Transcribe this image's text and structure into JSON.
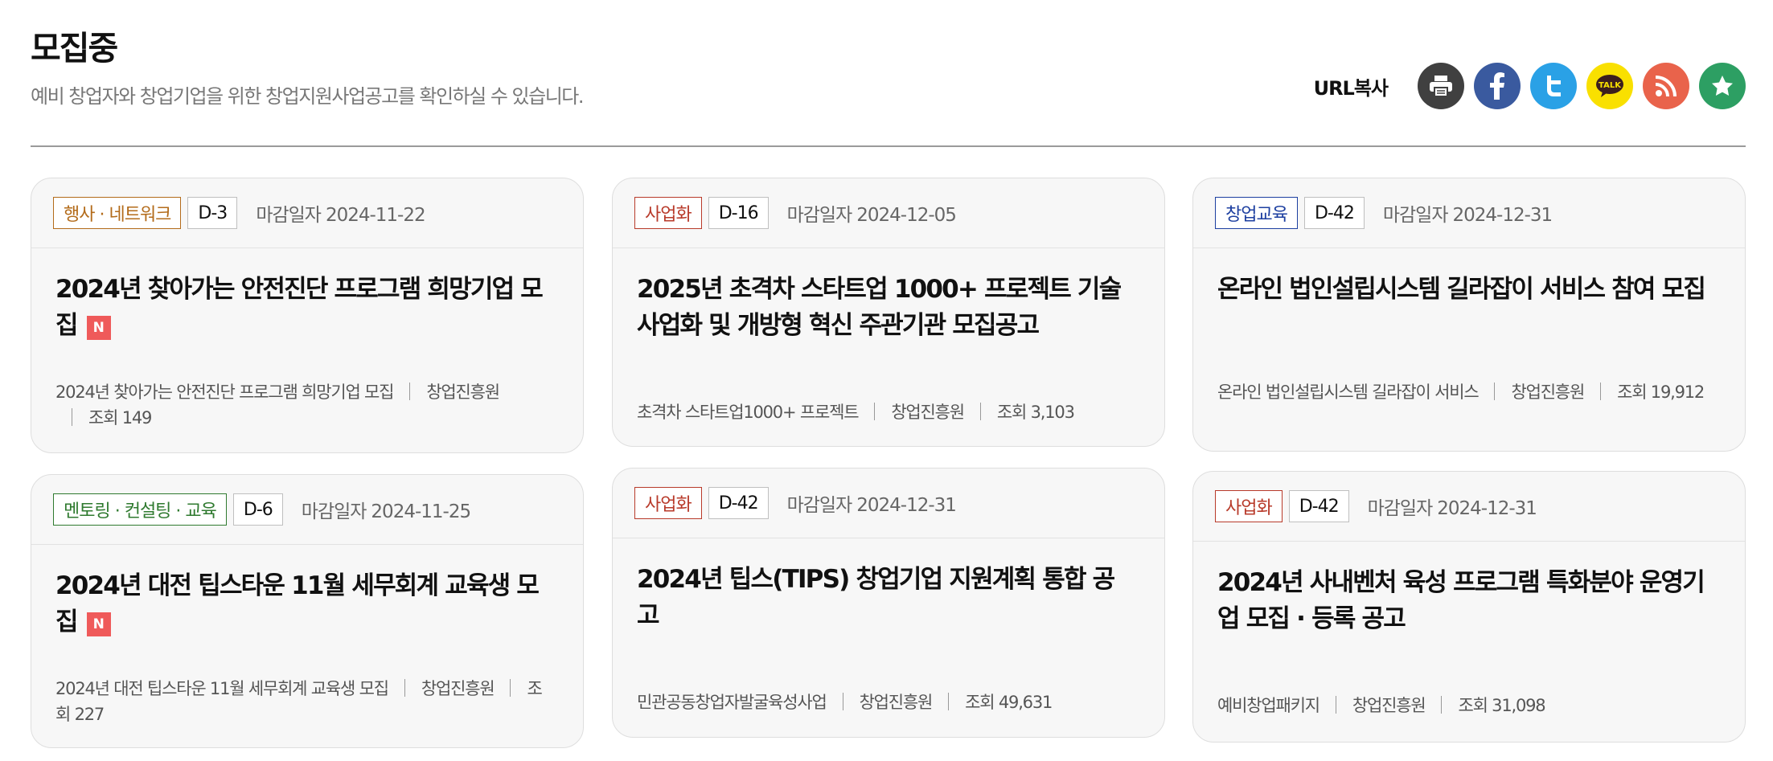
{
  "page": {
    "title": "모집중",
    "subtitle": "예비 창업자와 창업기업을 위한 창업지원사업공고를 확인하실 수 있습니다."
  },
  "share": {
    "url_copy_label": "URL복사",
    "kakao_label": "TALK",
    "colors": {
      "print": "#404040",
      "facebook": "#3a5a9f",
      "twitter": "#2aa1e6",
      "kakao": "#f9e000",
      "rss": "#e9634b",
      "favorite": "#2d9f63"
    }
  },
  "deadline_label": "마감일자",
  "new_label": "N",
  "cards": [
    {
      "category": "행사 · 네트워크",
      "category_color": "#b36b1a",
      "dday": "D-3",
      "deadline": "2024-11-22",
      "title": "2024년 찾아가는 안전진단 프로그램 희망기업 모집",
      "is_new": true,
      "business": "2024년 찾아가는 안전진단 프로그램 희망기업 모집",
      "org": "창업진흥원",
      "views": "조회 149"
    },
    {
      "category": "사업화",
      "category_color": "#b83a2a",
      "dday": "D-16",
      "deadline": "2024-12-05",
      "title": "2025년 초격차 스타트업 1000+ 프로젝트 기술사업화 및 개방형 혁신 주관기관 모집공고",
      "is_new": false,
      "business": "초격차 스타트업1000+ 프로젝트",
      "org": "창업진흥원",
      "views": "조회 3,103"
    },
    {
      "category": "창업교육",
      "category_color": "#1d3fa0",
      "dday": "D-42",
      "deadline": "2024-12-31",
      "title": "온라인 법인설립시스템 길라잡이 서비스 참여 모집",
      "is_new": false,
      "business": "온라인 법인설립시스템 길라잡이 서비스",
      "org": "창업진흥원",
      "views": "조회 19,912"
    },
    {
      "category": "멘토링 · 컨설팅 · 교육",
      "category_color": "#2f7a2f",
      "dday": "D-6",
      "deadline": "2024-11-25",
      "title": "2024년 대전 팁스타운 11월 세무회계 교육생 모집",
      "is_new": true,
      "business": "2024년 대전 팁스타운 11월 세무회계 교육생 모집",
      "org": "창업진흥원",
      "views": "조회 227"
    },
    {
      "category": "사업화",
      "category_color": "#b83a2a",
      "dday": "D-42",
      "deadline": "2024-12-31",
      "title": "2024년 팁스(TIPS) 창업기업 지원계획 통합 공고",
      "is_new": false,
      "business": "민관공동창업자발굴육성사업",
      "org": "창업진흥원",
      "views": "조회 49,631"
    },
    {
      "category": "사업화",
      "category_color": "#b83a2a",
      "dday": "D-42",
      "deadline": "2024-12-31",
      "title": "2024년 사내벤처 육성 프로그램 특화분야 운영기업 모집 · 등록 공고",
      "is_new": false,
      "business": "예비창업패키지",
      "org": "창업진흥원",
      "views": "조회 31,098"
    }
  ]
}
